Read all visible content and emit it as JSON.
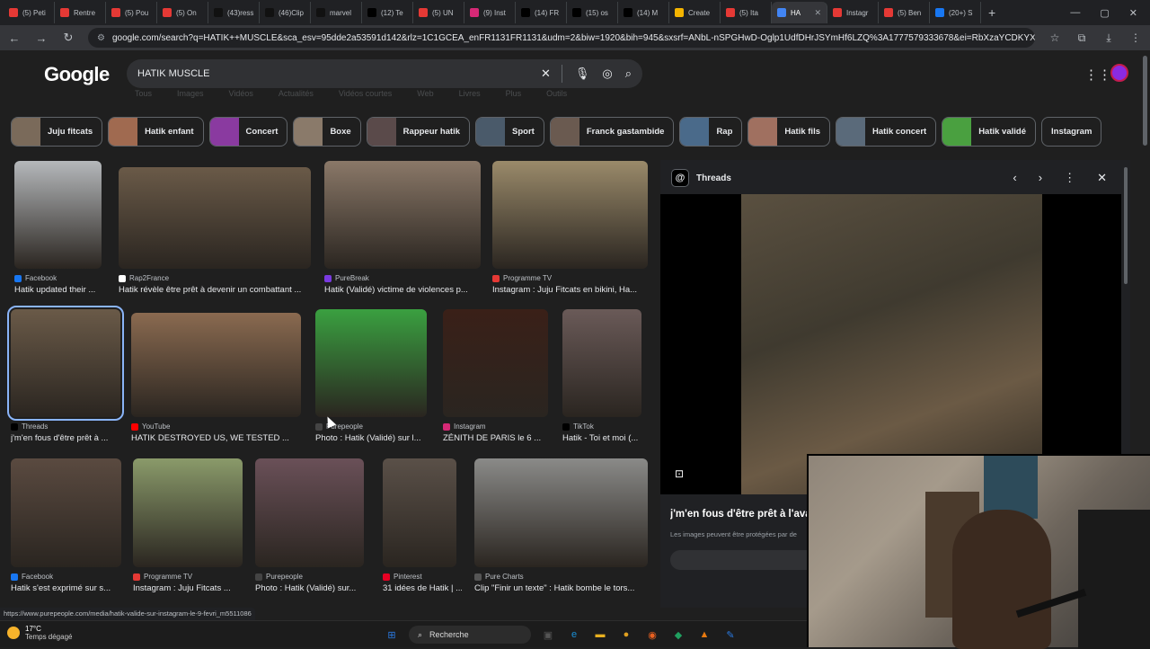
{
  "tabs": [
    {
      "label": "(5) Peti",
      "color": "#e53935"
    },
    {
      "label": "Rentre",
      "color": "#e53935"
    },
    {
      "label": "(5) Pou",
      "color": "#e53935"
    },
    {
      "label": "(5) On",
      "color": "#e53935"
    },
    {
      "label": "(43)ress",
      "color": "#111111"
    },
    {
      "label": "(46)Clip",
      "color": "#111111"
    },
    {
      "label": "marvel",
      "color": "#111111"
    },
    {
      "label": "(12) Te",
      "color": "#000000"
    },
    {
      "label": "(5) UN",
      "color": "#e53935"
    },
    {
      "label": "(9) Inst",
      "color": "#d62976"
    },
    {
      "label": "(14) FR",
      "color": "#000000"
    },
    {
      "label": "(15) os",
      "color": "#000000"
    },
    {
      "label": "(14) M",
      "color": "#000000"
    },
    {
      "label": "Create",
      "color": "#f4b400"
    },
    {
      "label": "(5) Ita",
      "color": "#e53935"
    },
    {
      "label": "HA",
      "color": "#4285f4",
      "active": true
    },
    {
      "label": "Instagr",
      "color": "#e53935"
    },
    {
      "label": "(5) Ben",
      "color": "#e53935"
    },
    {
      "label": "(20+) S",
      "color": "#1877f2"
    }
  ],
  "window": {
    "new_tab": "+",
    "minimize": "—",
    "maximize": "▢",
    "close": "✕"
  },
  "toolbar": {
    "back": "←",
    "forward": "→",
    "reload": "↻",
    "tune": "⚙",
    "url": "google.com/search?q=HATIK++MUSCLE&sca_esv=95dde2a53591d142&rlz=1C1GCEA_enFR1131FR1131&udm=2&biw=1920&bih=945&sxsrf=ANbL-nSPGHwD-Oglp1UdfDHrJSYmHf6LZQ%3A1777579333678&ei=RbXzaYCDKYXX7M8P26q8m...",
    "star": "☆",
    "ext": "⧉",
    "download": "⤓",
    "menu": "⋮"
  },
  "google": {
    "logo": "Google",
    "query": "HATIK MUSCLE",
    "clear": "✕",
    "mic": "🎙",
    "lens": "◎",
    "search": "⌕",
    "apps": "⋮⋮⋮",
    "subnav": [
      "Tous",
      "Images",
      "Vidéos",
      "Actualités",
      "Vidéos courtes",
      "Web",
      "Livres",
      "Plus",
      "Outils"
    ]
  },
  "chips": [
    {
      "label": "Juju fitcats",
      "color": "#7a6a5a"
    },
    {
      "label": "Hatik enfant",
      "color": "#a06a50"
    },
    {
      "label": "Concert",
      "color": "#8a3aa0"
    },
    {
      "label": "Boxe",
      "color": "#8a7a6a"
    },
    {
      "label": "Rappeur hatik",
      "color": "#5a4a4a"
    },
    {
      "label": "Sport",
      "color": "#4a5a6a"
    },
    {
      "label": "Franck gastambide",
      "color": "#6a5a50"
    },
    {
      "label": "Rap",
      "color": "#4a6a8a"
    },
    {
      "label": "Hatik fils",
      "color": "#a07060"
    },
    {
      "label": "Hatik concert",
      "color": "#5a6a7a"
    },
    {
      "label": "Hatik validé",
      "color": "#4aa040"
    },
    {
      "label": "Instagram",
      "color": ""
    }
  ],
  "results": [
    {
      "source": "Facebook",
      "caption": "Hatik updated their ...",
      "sc": "#1877f2",
      "img": "#b5b8bb"
    },
    {
      "source": "Rap2France",
      "caption": "Hatik révèle être prêt à devenir un combattant ...",
      "sc": "#ffffff",
      "img": "#6a5a48"
    },
    {
      "source": "PureBreak",
      "caption": "Hatik (Validé) victime de violences p...",
      "sc": "#7a3ae0",
      "img": "#8a7868"
    },
    {
      "source": "Programme TV",
      "caption": "Instagram : Juju Fitcats en bikini, Ha...",
      "sc": "#e53935",
      "img": "#9a8a6a"
    },
    {
      "source": "Threads",
      "caption": "j'm'en fous d'être prêt à ...",
      "sc": "#000000",
      "img": "#6a5a48",
      "selected": true
    },
    {
      "source": "YouTube",
      "caption": "HATIK DESTROYED US, WE TESTED ...",
      "sc": "#ff0000",
      "img": "#8a6a50"
    },
    {
      "source": "Purepeople",
      "caption": "Photo : Hatik (Validé) sur l...",
      "sc": "#444444",
      "img": "#3aa040"
    },
    {
      "source": "Instagram",
      "caption": "ZÉNITH DE PARIS le 6 ...",
      "sc": "#d62976",
      "img": "#3a2018"
    },
    {
      "source": "TikTok",
      "caption": "Hatik - Toi et moi (...",
      "sc": "#000000",
      "img": "#6a5a58"
    },
    {
      "source": "Facebook",
      "caption": "Hatik s'est exprimé sur s...",
      "sc": "#1877f2",
      "img": "#5a4a40"
    },
    {
      "source": "Programme TV",
      "caption": "Instagram : Juju Fitcats ...",
      "sc": "#e53935",
      "img": "#8a9a6a"
    },
    {
      "source": "Purepeople",
      "caption": "Photo : Hatik (Validé) sur...",
      "sc": "#444444",
      "img": "#6a5058"
    },
    {
      "source": "Pinterest",
      "caption": "31 idées de Hatik | ...",
      "sc": "#e60023",
      "img": "#5a5048"
    },
    {
      "source": "Pure Charts",
      "caption": "Clip \"Finir un texte\" : Hatik bombe le tors...",
      "sc": "#555555",
      "img": "#8a8a88"
    }
  ],
  "panel": {
    "site": "Threads",
    "logo": "@",
    "prev": "‹",
    "next": "›",
    "more": "⋮",
    "close": "✕",
    "lens": "⊡",
    "title": "j'm'en fous d'être prêt à l'ava",
    "note": "Les images peuvent être protégées par de",
    "share": "↗ Partager"
  },
  "status": {
    "url": "https://www.purepeople.com/media/hatik-valide-sur-instagram-le-9-fevri_m5511086"
  },
  "taskbar": {
    "temp": "17°C",
    "weather": "Temps dégagé",
    "search": "Recherche",
    "icons": [
      {
        "name": "windows",
        "glyph": "⊞",
        "color": "#2a7ae2"
      },
      {
        "name": "taskview",
        "glyph": "▣",
        "color": "#555555"
      },
      {
        "name": "edge",
        "glyph": "e",
        "color": "#1a8fd6"
      },
      {
        "name": "explorer",
        "glyph": "▬",
        "color": "#e8b020"
      },
      {
        "name": "chrome",
        "glyph": "●",
        "color": "#e0a020"
      },
      {
        "name": "firefox",
        "glyph": "◉",
        "color": "#e86020"
      },
      {
        "name": "app",
        "glyph": "◆",
        "color": "#20a060"
      },
      {
        "name": "vlc",
        "glyph": "▲",
        "color": "#e87a10"
      },
      {
        "name": "app2",
        "glyph": "✎",
        "color": "#2a7ae2"
      }
    ]
  }
}
